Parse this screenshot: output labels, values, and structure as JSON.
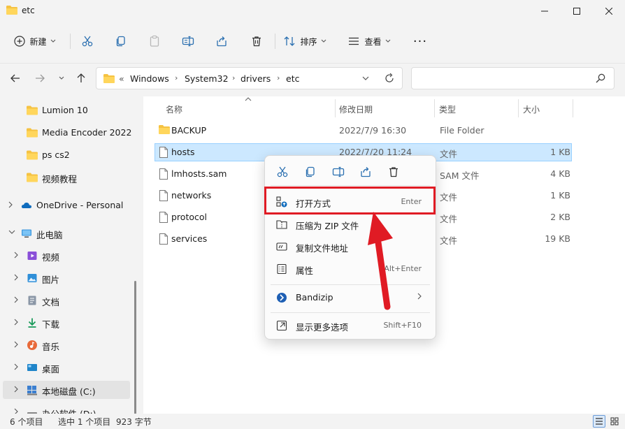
{
  "window": {
    "title": "etc"
  },
  "toolbar": {
    "new_label": "新建",
    "sort_label": "排序",
    "view_label": "查看",
    "more_label": "···"
  },
  "address": {
    "overflow": "«",
    "crumbs": [
      "Windows",
      "System32",
      "drivers",
      "etc"
    ]
  },
  "search": {
    "placeholder": ""
  },
  "sidebar": {
    "items": [
      {
        "label": "Lumion 10",
        "icon": "folder-icon"
      },
      {
        "label": "Media Encoder 2022",
        "icon": "folder-icon"
      },
      {
        "label": "ps cs2",
        "icon": "folder-icon"
      },
      {
        "label": "视频教程",
        "icon": "folder-icon"
      },
      {
        "label": "OneDrive - Personal",
        "icon": "onedrive-icon"
      },
      {
        "label": "此电脑",
        "icon": "pc-icon"
      },
      {
        "label": "视频",
        "icon": "video-icon"
      },
      {
        "label": "图片",
        "icon": "pictures-icon"
      },
      {
        "label": "文档",
        "icon": "documents-icon"
      },
      {
        "label": "下载",
        "icon": "download-icon"
      },
      {
        "label": "音乐",
        "icon": "music-icon"
      },
      {
        "label": "桌面",
        "icon": "desktop-icon"
      },
      {
        "label": "本地磁盘 (C:)",
        "icon": "drive-icon"
      },
      {
        "label": "办公软件 (D:)",
        "icon": "drive-icon"
      }
    ]
  },
  "columns": {
    "name": "名称",
    "date": "修改日期",
    "type": "类型",
    "size": "大小"
  },
  "files": [
    {
      "name": "BACKUP",
      "date": "2022/7/9 16:30",
      "type": "File Folder",
      "size": ""
    },
    {
      "name": "hosts",
      "date": "2022/7/20 11:24",
      "type": "文件",
      "size": "1 KB"
    },
    {
      "name": "lmhosts.sam",
      "date": "",
      "type": "SAM 文件",
      "size": "4 KB"
    },
    {
      "name": "networks",
      "date": "",
      "type": "文件",
      "size": "1 KB"
    },
    {
      "name": "protocol",
      "date": "",
      "type": "文件",
      "size": "2 KB"
    },
    {
      "name": "services",
      "date": "",
      "type": "文件",
      "size": "19 KB"
    }
  ],
  "context_menu": {
    "items": [
      {
        "label": "打开方式",
        "shortcut": "Enter"
      },
      {
        "label": "压缩为 ZIP 文件",
        "shortcut": ""
      },
      {
        "label": "复制文件地址",
        "shortcut": ""
      },
      {
        "label": "属性",
        "shortcut": "Alt+Enter"
      },
      {
        "label": "Bandizip",
        "shortcut": ""
      },
      {
        "label": "显示更多选项",
        "shortcut": "Shift+F10"
      }
    ]
  },
  "status": {
    "count": "6 个项目",
    "selected": "选中 1 个项目",
    "size": "923 字节"
  },
  "colors": {
    "accent": "#0067c0",
    "folder": "#f5c242",
    "selection": "#cce8ff",
    "highlight": "#e01b24"
  }
}
